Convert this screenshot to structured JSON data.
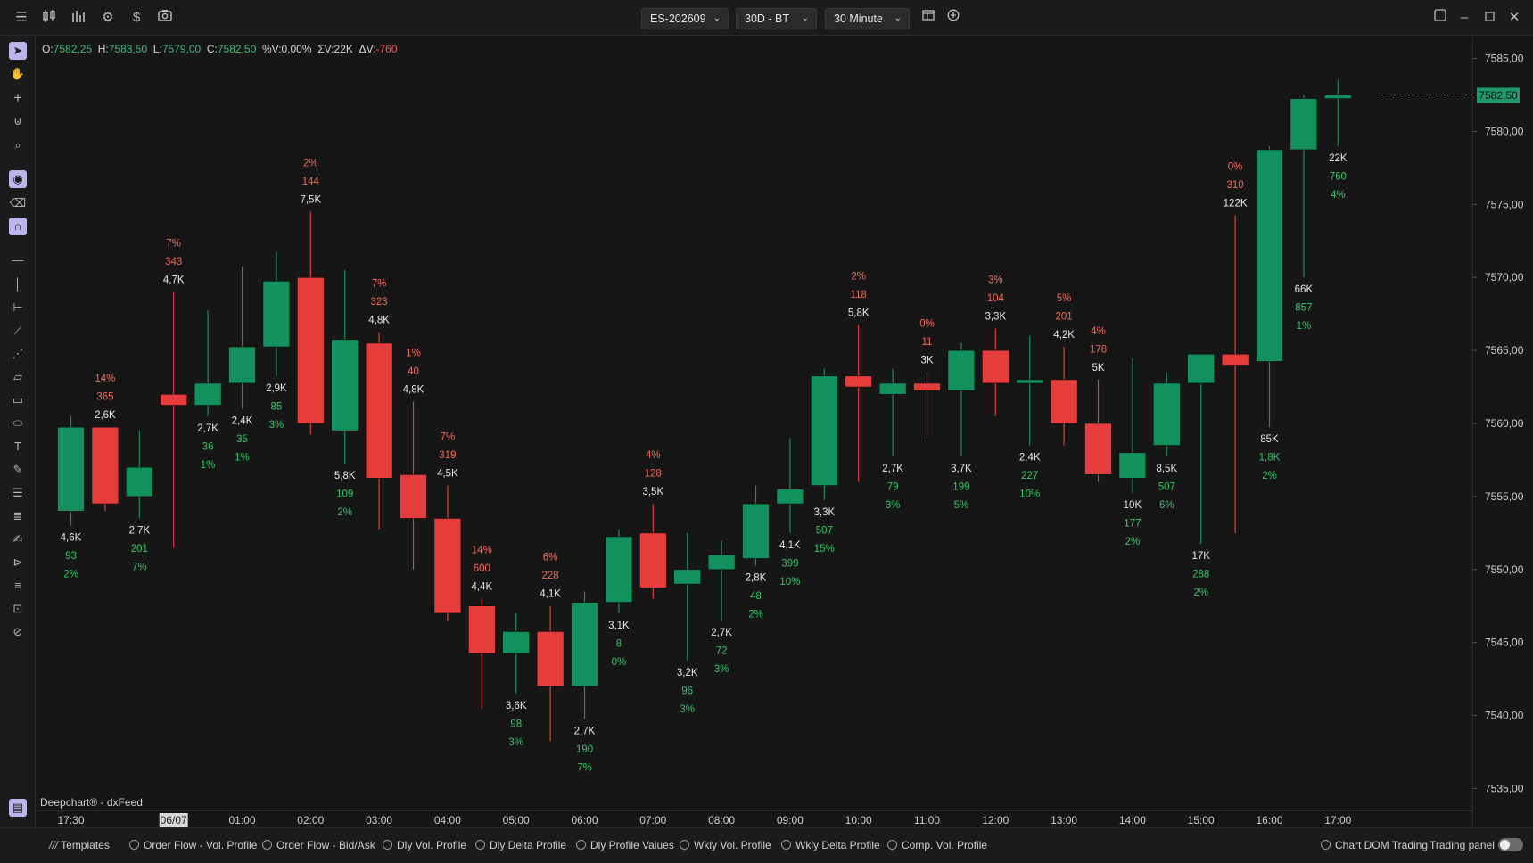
{
  "toolbar": {
    "symbol": "ES-202609",
    "range": "30D - BT",
    "interval": "30 Minute"
  },
  "ohlc": {
    "o_label": "O:",
    "o": "7582,25",
    "h_label": "H:",
    "h": "7583,50",
    "l_label": "L:",
    "l": "7579,00",
    "c_label": "C:",
    "c": "7582,50",
    "pv_label": "%V:",
    "pv": "0,00%",
    "sv_label": "ΣV:",
    "sv": "22K",
    "dv_label": "ΔV:",
    "dv": "-760"
  },
  "watermark": "Deepchart® - dxFeed",
  "colors": {
    "up": "#12915e",
    "down": "#e53c3c",
    "up_text": "#35c76b",
    "down_text": "#f26b5a",
    "bg": "#161616"
  },
  "chart_data": {
    "type": "candlestick",
    "y_range": [
      7533.5,
      7586.5
    ],
    "y_ticks": [
      "7585,00",
      "7580,00",
      "7575,00",
      "7570,00",
      "7565,00",
      "7560,00",
      "7555,00",
      "7550,00",
      "7545,00",
      "7540,00",
      "7535,00"
    ],
    "y_tick_values": [
      7585,
      7580,
      7575,
      7570,
      7565,
      7560,
      7555,
      7550,
      7545,
      7540,
      7535
    ],
    "x_ticks": [
      "17:30",
      "06/07",
      "01:00",
      "02:00",
      "03:00",
      "04:00",
      "05:00",
      "06:00",
      "07:00",
      "08:00",
      "09:00",
      "10:00",
      "11:00",
      "12:00",
      "13:00",
      "14:00",
      "15:00",
      "16:00",
      "17:00"
    ],
    "x_tick_bars": [
      0,
      3,
      5,
      7,
      9,
      11,
      13,
      15,
      17,
      19,
      21,
      23,
      25,
      27,
      29,
      31,
      33,
      35,
      37
    ],
    "last_price_label": "7582,50",
    "last_price": 7582.5,
    "candles": [
      {
        "o": 7554,
        "h": 7560.5,
        "l": 7553,
        "c": 7559.75,
        "stats": [
          "4,6K",
          "93",
          "2%"
        ],
        "pos": "below"
      },
      {
        "o": 7559.75,
        "h": 7559.75,
        "l": 7554,
        "c": 7554.5,
        "stats": [
          "14%",
          "365",
          "2,6K"
        ],
        "pos": "above"
      },
      {
        "o": 7555,
        "h": 7559.5,
        "l": 7553.5,
        "c": 7557,
        "stats": [
          "2,7K",
          "201",
          "7%"
        ],
        "pos": "below"
      },
      {
        "o": 7562,
        "h": 7569,
        "l": 7551.5,
        "c": 7561.25,
        "stats": [
          "7%",
          "343",
          "4,7K"
        ],
        "pos": "above"
      },
      {
        "o": 7561.25,
        "h": 7567.75,
        "l": 7560.5,
        "c": 7562.75,
        "stats": [
          "2,7K",
          "36",
          "1%"
        ],
        "pos": "below"
      },
      {
        "o": 7562.75,
        "h": 7570.75,
        "l": 7561,
        "c": 7565.25,
        "stats": [
          "2,4K",
          "35",
          "1%"
        ],
        "pos": "below"
      },
      {
        "o": 7565.25,
        "h": 7571.75,
        "l": 7563.25,
        "c": 7569.75,
        "stats": [
          "2,9K",
          "85",
          "3%"
        ],
        "pos": "below"
      },
      {
        "o": 7570,
        "h": 7574.5,
        "l": 7559.25,
        "c": 7560,
        "stats": [
          "2%",
          "144",
          "7,5K"
        ],
        "pos": "above"
      },
      {
        "o": 7559.5,
        "h": 7570.5,
        "l": 7557.25,
        "c": 7565.75,
        "stats": [
          "5,8K",
          "109",
          "2%"
        ],
        "pos": "below"
      },
      {
        "o": 7565.5,
        "h": 7566.25,
        "l": 7552.75,
        "c": 7556.25,
        "stats": [
          "7%",
          "323",
          "4,8K"
        ],
        "pos": "above"
      },
      {
        "o": 7556.5,
        "h": 7561.5,
        "l": 7550,
        "c": 7553.5,
        "stats": [
          "1%",
          "40",
          "4,8K"
        ],
        "pos": "above"
      },
      {
        "o": 7553.5,
        "h": 7555.75,
        "l": 7546.5,
        "c": 7547,
        "stats": [
          "7%",
          "319",
          "4,5K"
        ],
        "pos": "above"
      },
      {
        "o": 7547.5,
        "h": 7548,
        "l": 7540.5,
        "c": 7544.25,
        "stats": [
          "14%",
          "600",
          "4,4K"
        ],
        "pos": "above"
      },
      {
        "o": 7544.25,
        "h": 7547,
        "l": 7541.5,
        "c": 7545.75,
        "stats": [
          "3,6K",
          "98",
          "3%"
        ],
        "pos": "below"
      },
      {
        "o": 7545.75,
        "h": 7547.5,
        "l": 7538.25,
        "c": 7542,
        "stats": [
          "6%",
          "228",
          "4,1K"
        ],
        "pos": "above"
      },
      {
        "o": 7542,
        "h": 7548.5,
        "l": 7539.75,
        "c": 7547.75,
        "stats": [
          "2,7K",
          "190",
          "7%"
        ],
        "pos": "below"
      },
      {
        "o": 7547.75,
        "h": 7552.75,
        "l": 7547,
        "c": 7552.25,
        "stats": [
          "3,1K",
          "8",
          "0%"
        ],
        "pos": "below"
      },
      {
        "o": 7552.5,
        "h": 7554.5,
        "l": 7548,
        "c": 7548.75,
        "stats": [
          "4%",
          "128",
          "3,5K"
        ],
        "pos": "above"
      },
      {
        "o": 7549,
        "h": 7552.5,
        "l": 7543.75,
        "c": 7550,
        "stats": [
          "3,2K",
          "96",
          "3%"
        ],
        "pos": "below"
      },
      {
        "o": 7550,
        "h": 7552,
        "l": 7546.5,
        "c": 7551,
        "stats": [
          "2,7K",
          "72",
          "3%"
        ],
        "pos": "below"
      },
      {
        "o": 7550.75,
        "h": 7555.75,
        "l": 7550.25,
        "c": 7554.5,
        "stats": [
          "2,8K",
          "48",
          "2%"
        ],
        "pos": "below"
      },
      {
        "o": 7554.5,
        "h": 7559,
        "l": 7552.5,
        "c": 7555.5,
        "stats": [
          "4,1K",
          "399",
          "10%"
        ],
        "pos": "below"
      },
      {
        "o": 7555.75,
        "h": 7563.75,
        "l": 7554.75,
        "c": 7563.25,
        "stats": [
          "3,3K",
          "507",
          "15%"
        ],
        "pos": "below"
      },
      {
        "o": 7563.25,
        "h": 7566.75,
        "l": 7556,
        "c": 7562.5,
        "stats": [
          "2%",
          "118",
          "5,8K"
        ],
        "pos": "above"
      },
      {
        "o": 7562,
        "h": 7563.75,
        "l": 7557.75,
        "c": 7562.75,
        "stats": [
          "2,7K",
          "79",
          "3%"
        ],
        "pos": "below"
      },
      {
        "o": 7562.75,
        "h": 7563.5,
        "l": 7559,
        "c": 7562.25,
        "stats": [
          "0%",
          "11",
          "3K"
        ],
        "pos": "above"
      },
      {
        "o": 7562.25,
        "h": 7565.5,
        "l": 7557.75,
        "c": 7565,
        "stats": [
          "3,7K",
          "199",
          "5%"
        ],
        "pos": "below"
      },
      {
        "o": 7565,
        "h": 7566.5,
        "l": 7560.5,
        "c": 7562.75,
        "stats": [
          "3%",
          "104",
          "3,3K"
        ],
        "pos": "above"
      },
      {
        "o": 7562.75,
        "h": 7566,
        "l": 7558.5,
        "c": 7563,
        "stats": [
          "2,4K",
          "227",
          "10%"
        ],
        "pos": "below"
      },
      {
        "o": 7563,
        "h": 7565.25,
        "l": 7558.5,
        "c": 7560,
        "stats": [
          "5%",
          "201",
          "4,2K"
        ],
        "pos": "above"
      },
      {
        "o": 7560,
        "h": 7563,
        "l": 7556,
        "c": 7556.5,
        "stats": [
          "4%",
          "178",
          "5K"
        ],
        "pos": "above"
      },
      {
        "o": 7556.25,
        "h": 7564.5,
        "l": 7555.25,
        "c": 7558,
        "stats": [
          "10K",
          "177",
          "2%"
        ],
        "pos": "below"
      },
      {
        "o": 7558.5,
        "h": 7563.5,
        "l": 7557.75,
        "c": 7562.75,
        "stats": [
          "8,5K",
          "507",
          "6%"
        ],
        "pos": "below"
      },
      {
        "o": 7562.75,
        "h": 7564.75,
        "l": 7551.75,
        "c": 7564.75,
        "stats": [
          "17K",
          "288",
          "2%"
        ],
        "pos": "below"
      },
      {
        "o": 7564.75,
        "h": 7574.25,
        "l": 7552.5,
        "c": 7564,
        "stats": [
          "0%",
          "310",
          "122K"
        ],
        "pos": "above"
      },
      {
        "o": 7564.25,
        "h": 7579,
        "l": 7559.75,
        "c": 7578.75,
        "stats": [
          "85K",
          "1,8K",
          "2%"
        ],
        "pos": "below"
      },
      {
        "o": 7578.75,
        "h": 7582.5,
        "l": 7570,
        "c": 7582.25,
        "stats": [
          "66K",
          "857",
          "1%"
        ],
        "pos": "below"
      },
      {
        "o": 7582.25,
        "h": 7583.5,
        "l": 7579,
        "c": 7582.5,
        "stats": [
          "22K",
          "760",
          "4%"
        ],
        "pos": "below"
      }
    ]
  },
  "bottombar": {
    "templates": "Templates",
    "items": [
      "Order Flow - Vol. Profile",
      "Order Flow - Bid/Ask",
      "Dly Vol. Profile",
      "Dly Delta Profile",
      "Dly Profile Values",
      "Wkly Vol. Profile",
      "Wkly Delta Profile",
      "Comp. Vol. Profile"
    ],
    "chart_dom": "Chart DOM Trading",
    "trading_panel": "Trading panel"
  }
}
